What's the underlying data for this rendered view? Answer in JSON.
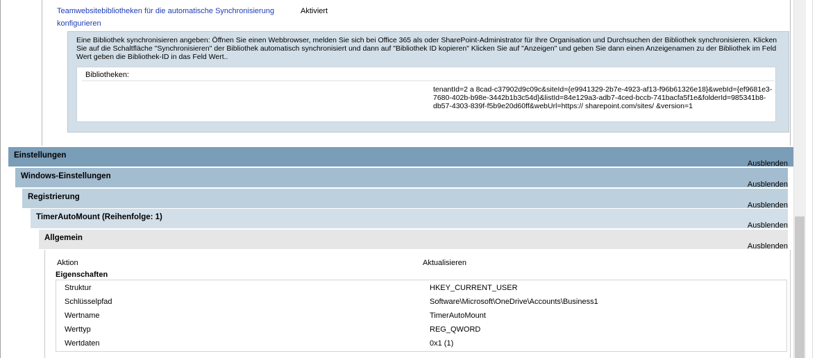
{
  "top": {
    "sync_label_line1": "Teamwebsitebibliotheken für die automatische Synchronisierung",
    "sync_label_line2": "konfigurieren",
    "sync_status": "Aktiviert",
    "description": "Eine Bibliothek synchronisieren angeben: Öffnen Sie einen Webbrowser, melden Sie sich bei Office 365 als oder SharePoint-Administrator für Ihre Organisation und Durchsuchen der Bibliothek synchronisieren. Klicken Sie auf die Schaltfläche \"Synchronisieren\" der Bibliothek automatisch synchronisiert und dann auf \"Bibliothek ID kopieren\" Klicken Sie auf \"Anzeigen\" und geben Sie dann einen Anzeigenamen zu der Bibliothek im Feld Wert geben die Bibliothek-ID in das Feld Wert..",
    "libraries_label": "Bibliotheken:",
    "library_value": "tenantId=2    a      8cad-c37902d9c09c&siteId={e9941329-2b7e-4923-af13-f96b61326e18}&webId={ef9681e3-7680-402b-b98e-3442b1b3c54d}&listId=84e129a3-adb7-4ced-bccb-741bacfa5f1e&folderId=985341b8-db57-4303-839f-f5b9e20d60ff&webUrl=https://      sharepoint.com/sites/     &version=1"
  },
  "sections": [
    {
      "title": "Einstellungen",
      "hide": "Ausblenden"
    },
    {
      "title": "Windows-Einstellungen",
      "hide": "Ausblenden"
    },
    {
      "title": "Registrierung",
      "hide": "Ausblenden"
    },
    {
      "title": "TimerAutoMount (Reihenfolge: 1)",
      "hide": "Ausblenden"
    },
    {
      "title": "Allgemein",
      "hide": "Ausblenden"
    }
  ],
  "general": {
    "action_label": "Aktion",
    "action_value": "Aktualisieren",
    "properties_heading": "Eigenschaften",
    "rows": [
      {
        "name": "Struktur",
        "value": "HKEY_CURRENT_USER"
      },
      {
        "name": "Schlüsselpfad",
        "value": "Software\\Microsoft\\OneDrive\\Accounts\\Business1"
      },
      {
        "name": "Wertname",
        "value": "TimerAutoMount"
      },
      {
        "name": "Werttyp",
        "value": "REG_QWORD"
      },
      {
        "name": "Wertdaten",
        "value": "0x1 (1)"
      }
    ]
  },
  "colors": {
    "bar1": "#7a9db8",
    "bar2": "#a3bccf",
    "bar3": "#bdd0de",
    "bar4": "#d2dfe9",
    "bar5": "#e6e6e6",
    "link": "#1f3cb4"
  }
}
